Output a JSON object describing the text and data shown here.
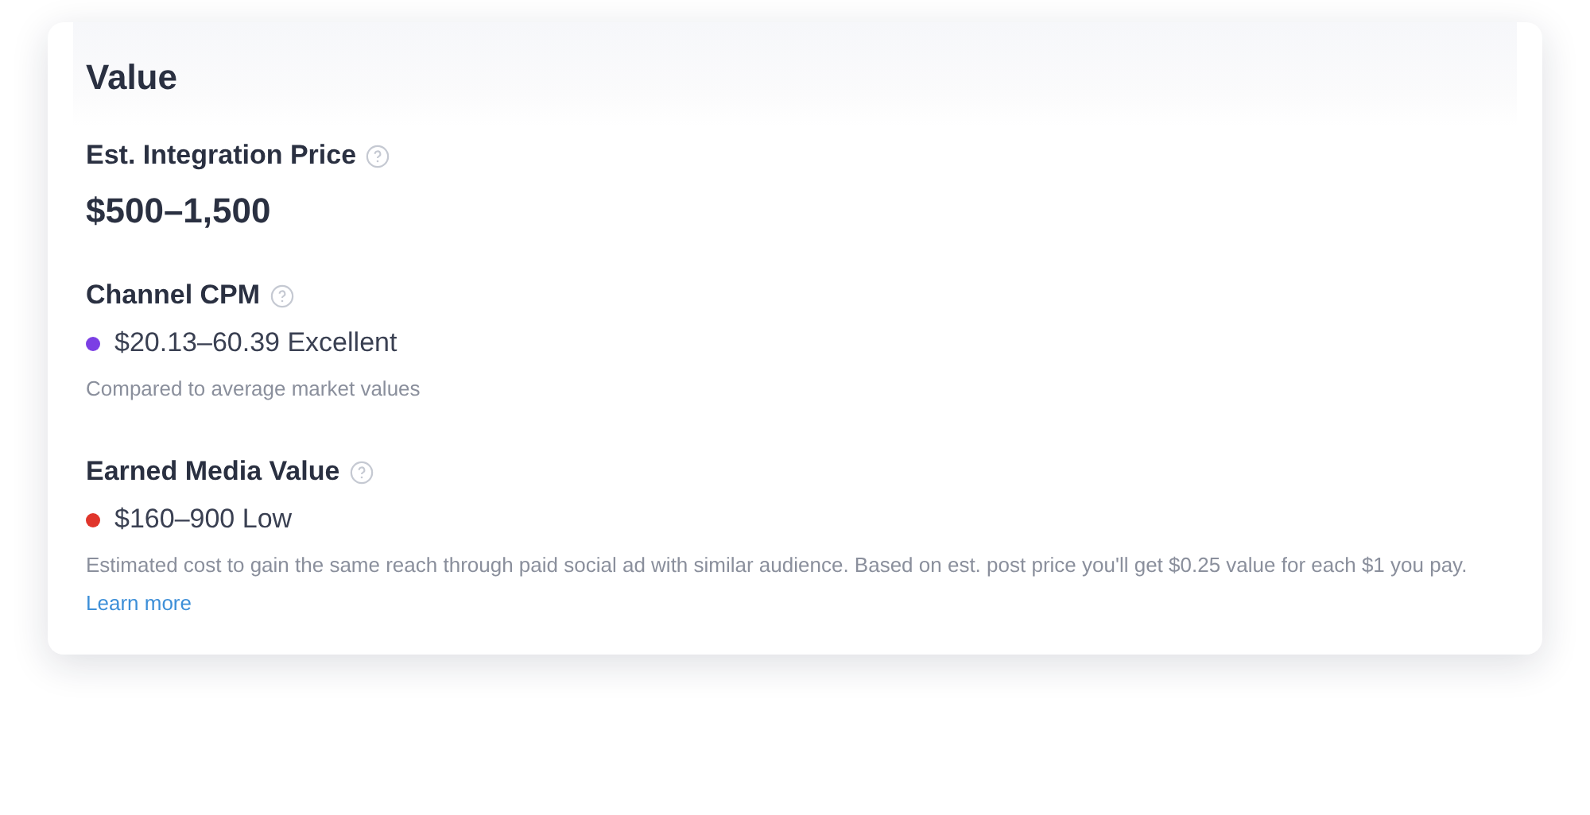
{
  "card": {
    "title": "Value",
    "sections": [
      {
        "kind": "price",
        "label": "Est. Integration Price",
        "value": "$500–1,500"
      },
      {
        "kind": "metric",
        "label": "Channel CPM",
        "color": "#7b3fe4",
        "reading": "$20.13–60.39 Excellent",
        "note": "Compared to average market values"
      },
      {
        "kind": "metric",
        "label": "Earned Media Value",
        "color": "#e0352b",
        "reading": "$160–900 Low",
        "note": "Estimated cost to gain the same reach through paid social ad with similar audience. Based on est. post price you'll get $0.25 value for each $1 you pay.",
        "link": "Learn more"
      }
    ]
  }
}
